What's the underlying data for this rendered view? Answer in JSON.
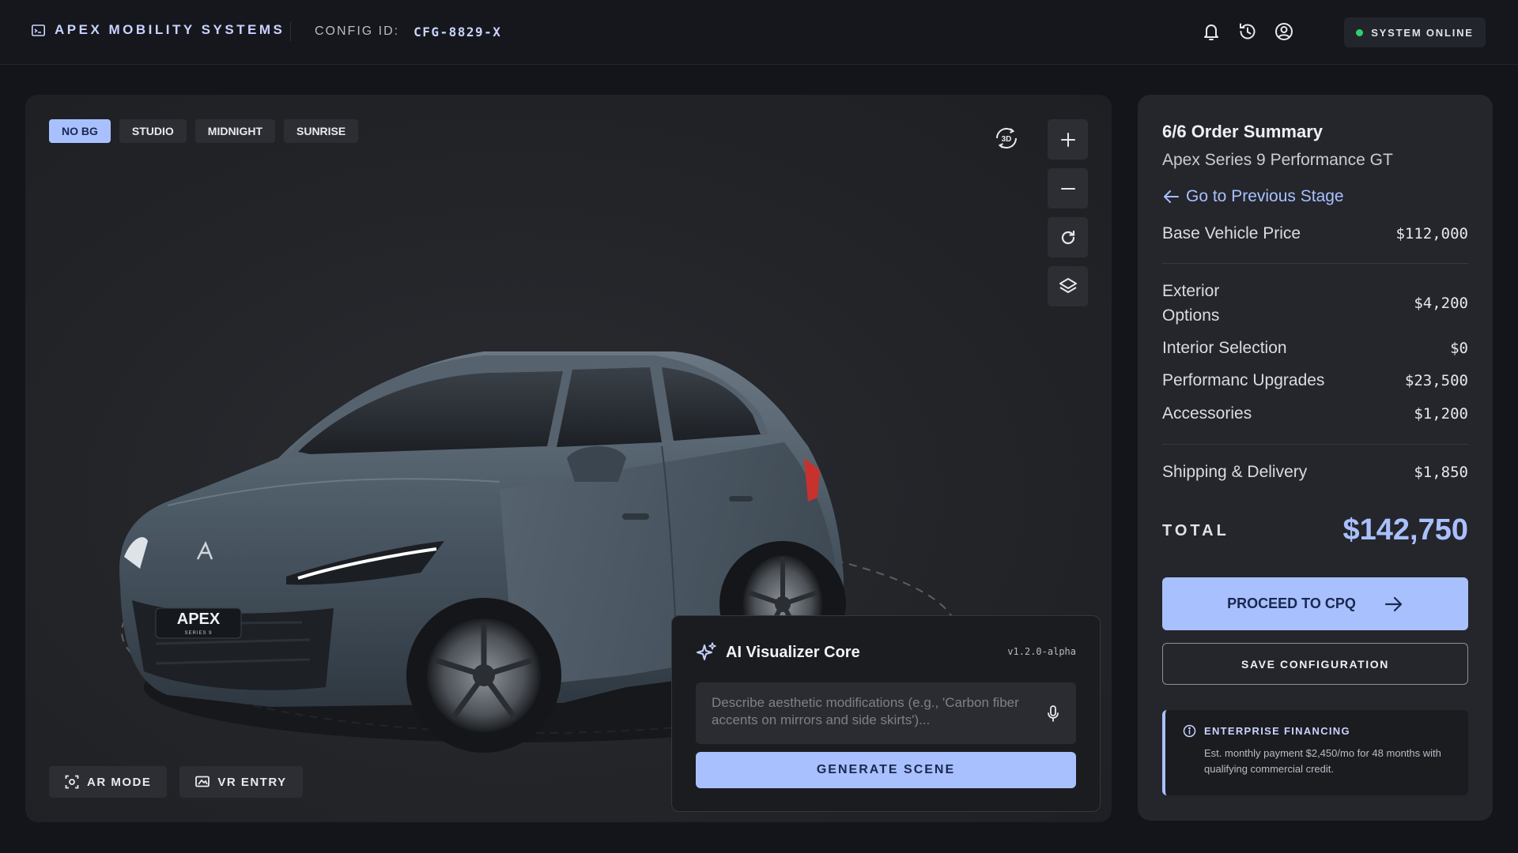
{
  "header": {
    "brand": "APEX MOBILITY SYSTEMS",
    "config_label": "CONFIG ID:",
    "config_id": "CFG-8829-X",
    "status": "SYSTEM ONLINE",
    "icons": [
      "bell-icon",
      "history-icon",
      "account-icon"
    ]
  },
  "viewer": {
    "backgrounds": [
      "NO BG",
      "STUDIO",
      "MIDNIGHT",
      "SUNRISE"
    ],
    "active_background": "NO BG",
    "tools": [
      "rotate-360-icon",
      "zoom-in-icon",
      "zoom-out-icon",
      "reset-view-icon",
      "layers-icon"
    ],
    "rotate_badge": "3D",
    "car_badge": "APEX",
    "car_badge_sub": "SERIES 9",
    "ar_mode": "AR MODE",
    "vr_entry": "VR ENTRY"
  },
  "ai": {
    "title": "AI Visualizer Core",
    "version": "v1.2.0-alpha",
    "placeholder": "Describe aesthetic modifications (e.g., 'Carbon fiber accents on mirrors and side skirts')...",
    "generate": "GENERATE SCENE"
  },
  "summary": {
    "title": "6/6 Order Summary",
    "model": "Apex Series 9 Performance GT",
    "back": "Go to Previous Stage",
    "rows": [
      {
        "label": "Base Vehicle Price",
        "value": "$112,000"
      },
      {
        "label": "Exterior Options",
        "value": "$4,200"
      },
      {
        "label": "Interior Selection",
        "value": "$0"
      },
      {
        "label": "Performanc Upgrades",
        "value": "$23,500"
      },
      {
        "label": "Accessories",
        "value": "$1,200"
      },
      {
        "label": "Shipping & Delivery",
        "value": "$1,850"
      }
    ],
    "total_label": "TOTAL",
    "total_value": "$142,750",
    "proceed": "PROCEED TO CPQ",
    "save": "SAVE CONFIGURATION",
    "finance_title": "ENTERPRISE FINANCING",
    "finance_text": "Est. monthly payment $2,450/mo for 48 months with qualifying commercial credit."
  },
  "colors": {
    "accent": "#a9c0ff",
    "background": "#13151a",
    "panel": "#24262c",
    "status_ok": "#2fcf6b",
    "car_paint": "#4c5a66"
  }
}
